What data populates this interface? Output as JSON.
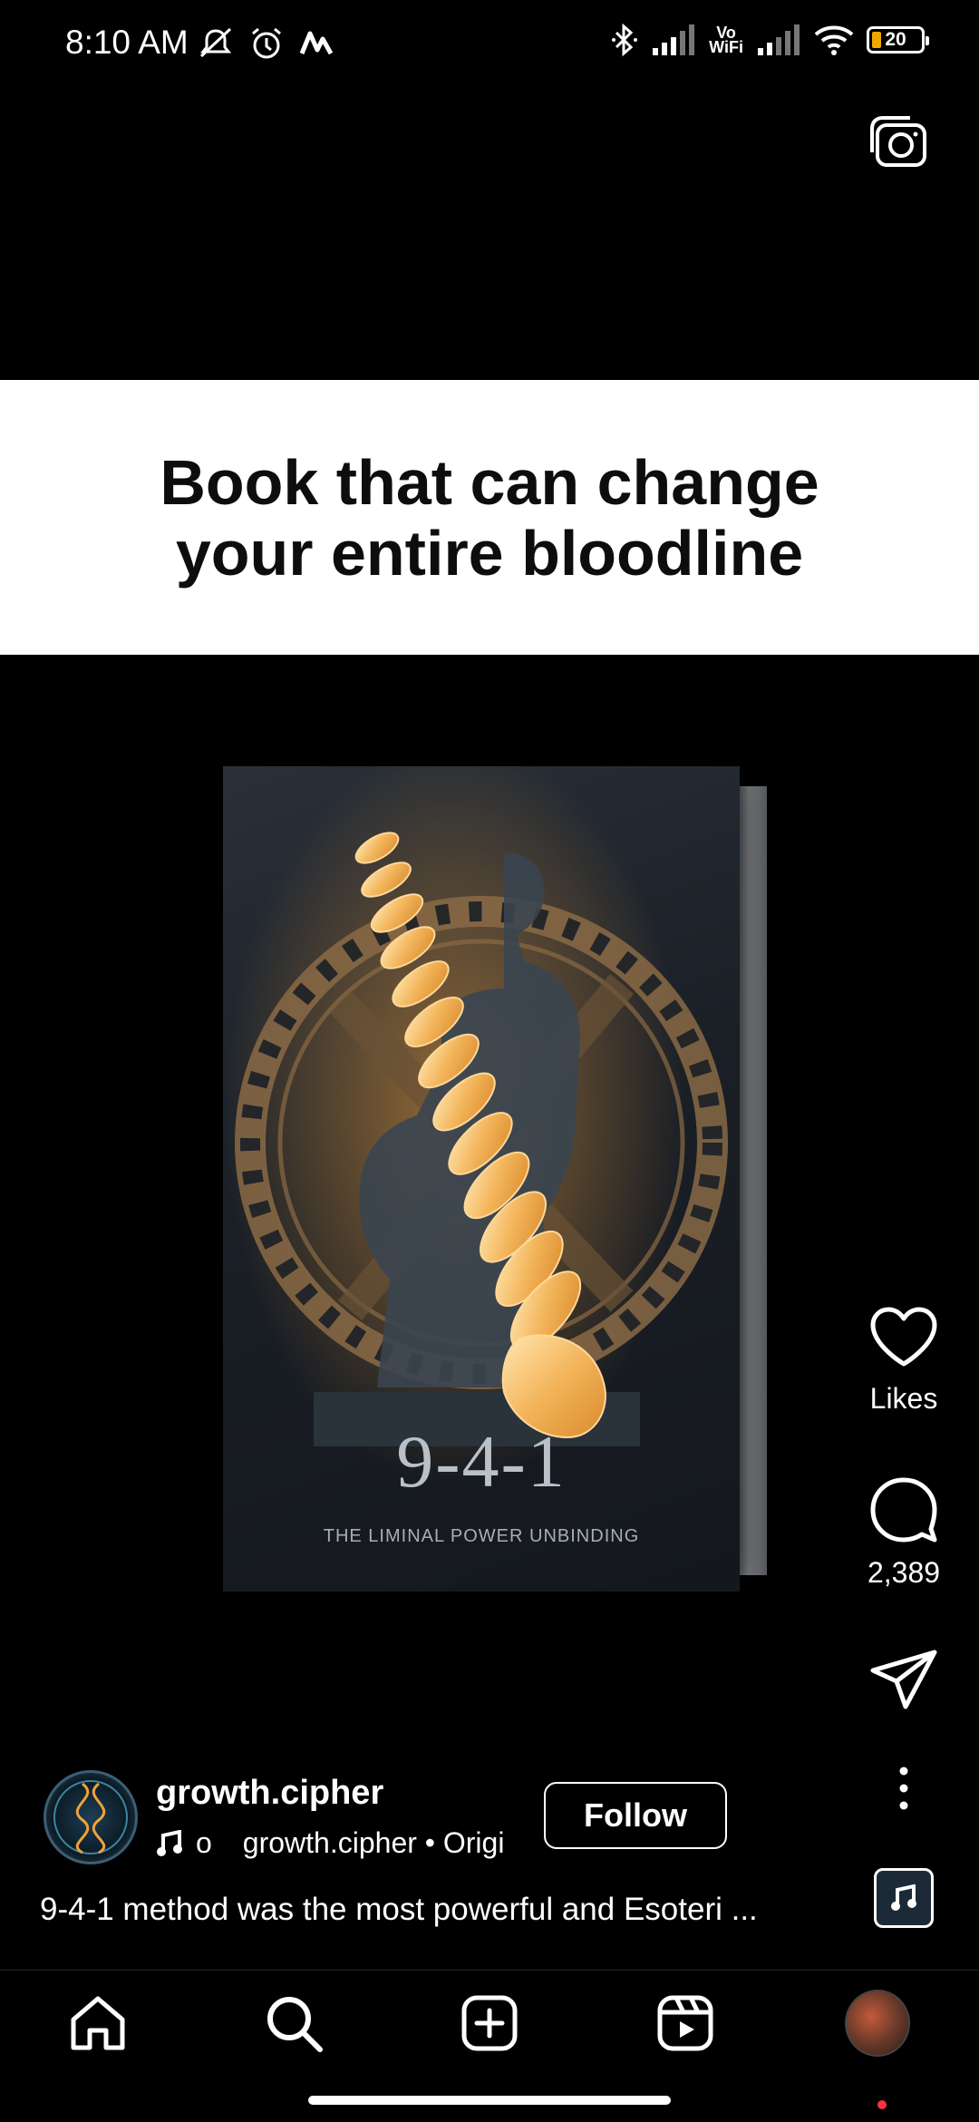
{
  "status_bar": {
    "time": "8:10 AM",
    "vowifi_top": "Vo",
    "vowifi_bottom": "WiFi",
    "battery": "20",
    "left_icons": [
      "mute-icon",
      "alarm-icon",
      "app-m-icon"
    ],
    "right_icons": [
      "bluetooth-icon",
      "signal-icon",
      "vowifi-icon",
      "signal-icon",
      "wifi-icon",
      "battery-icon"
    ]
  },
  "banner": {
    "title_line1": "Book that can change",
    "title_line2": "your entire bloodline"
  },
  "book": {
    "number": "9-4-1",
    "subtitle": "THE LIMINAL POWER UNBINDING"
  },
  "actions": {
    "likes_label": "Likes",
    "comments_count": "2,389"
  },
  "post": {
    "username": "growth.cipher",
    "audio_prefix": "o",
    "audio_text": "growth.cipher • Origi",
    "follow_label": "Follow",
    "caption": "9-4-1 method was the most powerful and Esoteri ..."
  },
  "nav": {
    "items": [
      "home-icon",
      "search-icon",
      "create-icon",
      "reels-icon",
      "profile-avatar"
    ]
  },
  "colors": {
    "background": "#000000",
    "banner": "#ffffff",
    "accent_glow": "#f0a23a",
    "notification": "#ff3040"
  }
}
